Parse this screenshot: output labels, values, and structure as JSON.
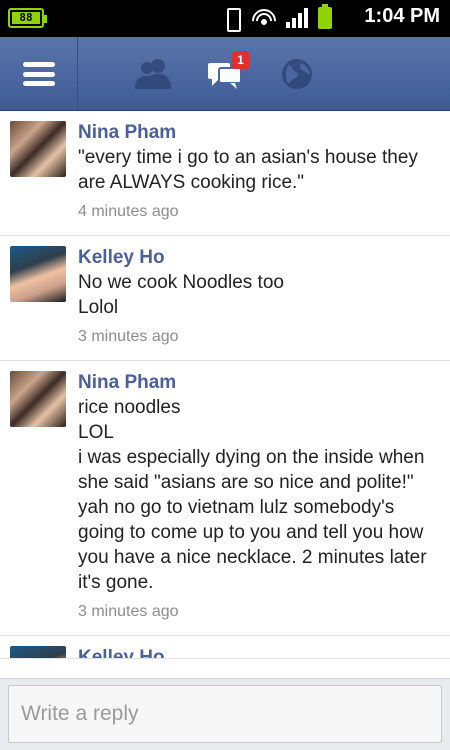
{
  "status_bar": {
    "battery_left": "88",
    "time": "1:04 PM",
    "icons": [
      "vibrate-icon",
      "wifi-icon",
      "signal-icon",
      "battery-icon"
    ],
    "battery_color": "#8fd400"
  },
  "header": {
    "nav_icons": [
      "menu-icon",
      "friends-icon",
      "messages-icon",
      "globe-icon"
    ],
    "messages_badge": "1",
    "bg_color": "#4a659f",
    "badge_color": "#e0302d"
  },
  "messages": [
    {
      "name": "Nina Pham",
      "text": "\"every time i go to an asian's house they are ALWAYS cooking rice.\"",
      "time": "4 minutes ago"
    },
    {
      "name": "Kelley Ho",
      "text": "No we cook Noodles too\nLolol",
      "time": "3 minutes ago"
    },
    {
      "name": "Nina Pham",
      "text": "rice noodles\nLOL\ni was especially dying on the inside when she said \"asians are so nice and polite!\"\nyah no go to vietnam lulz somebody's going to come up to you and tell you how you have a nice necklace. 2 minutes later it's gone.",
      "time": "3 minutes ago"
    },
    {
      "name": "Kelley Ho"
    }
  ],
  "reply": {
    "placeholder": "Write a reply",
    "value": ""
  },
  "colors": {
    "name_color": "#4a5f9c",
    "time_color": "#8d8d8d"
  }
}
